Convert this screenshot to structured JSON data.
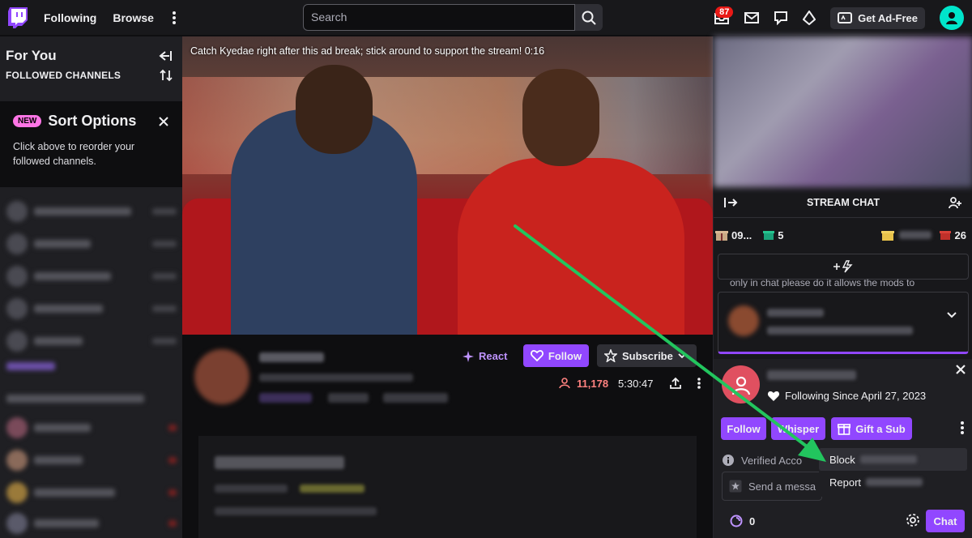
{
  "nav": {
    "following": "Following",
    "browse": "Browse",
    "search_placeholder": "Search",
    "inbox_count": "87",
    "ad_free": "Get Ad-Free"
  },
  "sidebar": {
    "title": "For You",
    "followed_heading": "FOLLOWED CHANNELS",
    "new_badge": "NEW",
    "sort_title": "Sort Options",
    "sort_text": "Click above to reorder your followed channels."
  },
  "video": {
    "ad_message": "Catch Kyedae right after this ad break; stick around to support the stream! 0:16"
  },
  "stream": {
    "react_label": "React",
    "follow_label": "Follow",
    "subscribe_label": "Subscribe",
    "viewers": "11,178",
    "uptime": "5:30:47"
  },
  "chat": {
    "header": "STREAM CHAT",
    "gift_count_a": "09...",
    "gift_count_b": "5",
    "gift_count_c": "26",
    "pinned_snippet": "only in chat please do it allows the mods to",
    "following_since": "Following Since April 27, 2023",
    "follow_btn": "Follow",
    "whisper_btn": "Whisper",
    "gift_sub_btn": "Gift a Sub",
    "verified_text": "Verified Acco",
    "send_placeholder": "Send a messa",
    "menu_block": "Block",
    "menu_report": "Report",
    "points": "0",
    "chat_btn": "Chat"
  },
  "colors": {
    "accent": "#9147ff",
    "arrow": "#22c55e"
  }
}
